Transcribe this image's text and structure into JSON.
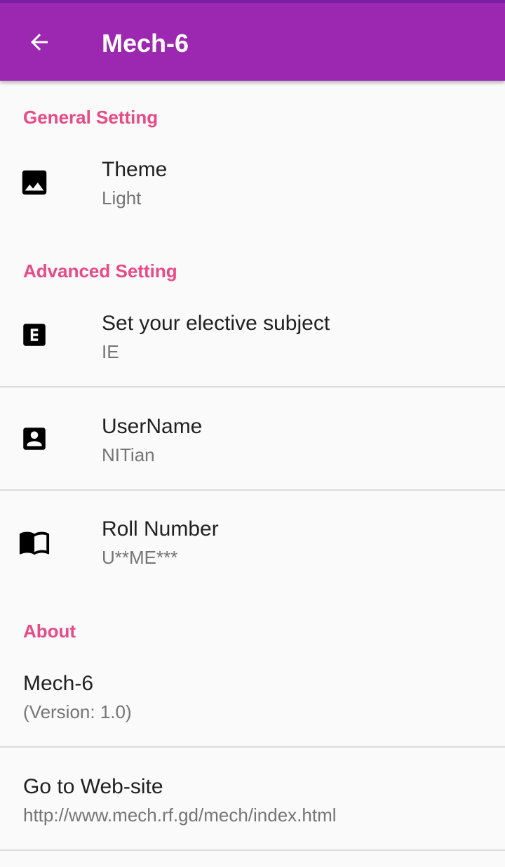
{
  "appbar": {
    "title": "Mech-6",
    "back_icon": "arrow-back-icon",
    "color": "#9c27b0"
  },
  "accent_color": "#e84a86",
  "sections": {
    "general": {
      "header": "General Setting"
    },
    "advanced": {
      "header": "Advanced Setting"
    },
    "about": {
      "header": "About"
    }
  },
  "prefs": {
    "theme": {
      "title": "Theme",
      "summary": "Light",
      "icon": "image-icon"
    },
    "elective": {
      "title": "Set your elective subject",
      "summary": "IE",
      "icon": "letter-e-icon"
    },
    "username": {
      "title": "UserName",
      "summary": "NITian",
      "icon": "account-box-icon"
    },
    "roll": {
      "title": "Roll Number",
      "summary": "U**ME***",
      "icon": "book-icon"
    },
    "app": {
      "title": "Mech-6",
      "summary": "(Version: 1.0)"
    },
    "website": {
      "title": "Go to Web-site",
      "summary": "http://www.mech.rf.gd/mech/index.html"
    }
  }
}
